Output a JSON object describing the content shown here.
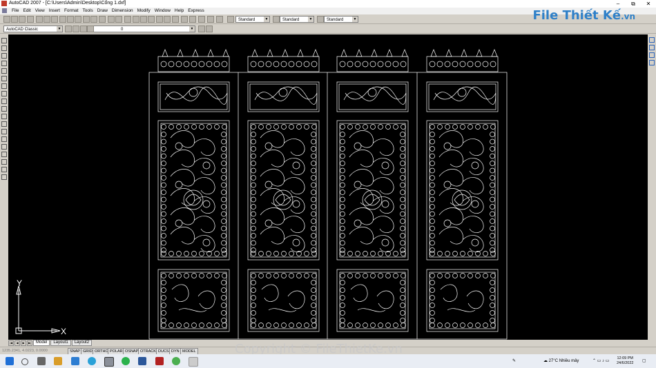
{
  "window": {
    "title": "AutoCAD 2007 - [C:\\Users\\Admin\\Desktop\\Cổng 1.dxf]",
    "controls": [
      "–",
      "⧉",
      "✕"
    ]
  },
  "menu": [
    "File",
    "Edit",
    "View",
    "Insert",
    "Format",
    "Tools",
    "Draw",
    "Dimension",
    "Modify",
    "Window",
    "Help",
    "Express"
  ],
  "toolbar": {
    "text_style": "Standard",
    "dim_style": "Standard",
    "table_style": "Standard",
    "workspace": "AutoCAD Classic",
    "layer": "0"
  },
  "brand": {
    "name": "File Thiết Kế",
    "suffix": ".vn"
  },
  "ucs": {
    "y": "Y",
    "x": "X"
  },
  "layout_tabs": [
    "Model",
    "Layout1",
    "Layout2"
  ],
  "status": {
    "coords": "1235.2341, 4.0223, 0.0000",
    "toggles": [
      "SNAP",
      "GRID",
      "ORTHO",
      "POLAR",
      "OSNAP",
      "OTRACK",
      "DUCS",
      "DYN",
      "MODEL"
    ]
  },
  "taskbar": {
    "weather": "27°C  Nhiều mây",
    "time": "12:09 PM",
    "date": "24/6/2022"
  },
  "watermark": "Copyright © FileThietKe.vn"
}
